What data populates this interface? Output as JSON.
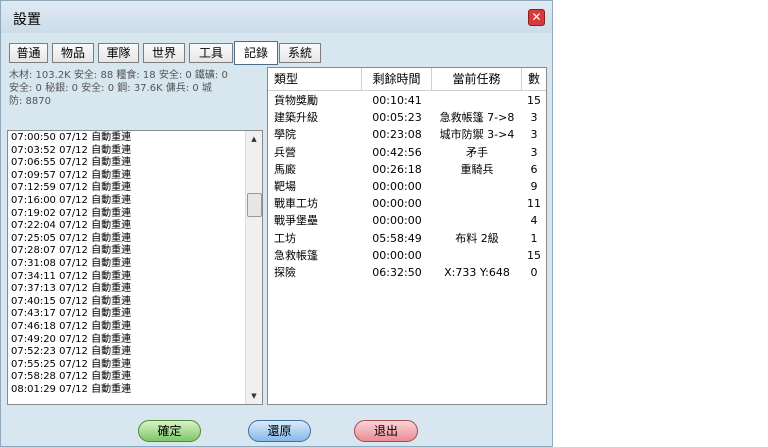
{
  "window": {
    "title": "設置",
    "close_icon": "close-icon"
  },
  "tabs": [
    {
      "label": "普通"
    },
    {
      "label": "物品"
    },
    {
      "label": "軍隊"
    },
    {
      "label": "世界"
    },
    {
      "label": "工具"
    },
    {
      "label": "記錄",
      "active": true
    },
    {
      "label": "系統"
    }
  ],
  "resources": {
    "line1": "木材: 103.2K 安全: 88  糧食: 18 安全: 0  鐵礦: 0",
    "line2": "安全: 0  秘銀: 0 安全: 0  鋼: 37.6K  傭兵: 0  城",
    "line3": "防: 8870"
  },
  "log": [
    "07:00:50 07/12  自動重連",
    "07:03:52 07/12  自動重連",
    "07:06:55 07/12  自動重連",
    "07:09:57 07/12  自動重連",
    "07:12:59 07/12  自動重連",
    "07:16:00 07/12  自動重連",
    "07:19:02 07/12  自動重連",
    "07:22:04 07/12  自動重連",
    "07:25:05 07/12  自動重連",
    "07:28:07 07/12  自動重連",
    "07:31:08 07/12  自動重連",
    "07:34:11 07/12  自動重連",
    "07:37:13 07/12  自動重連",
    "07:40:15 07/12  自動重連",
    "07:43:17 07/12  自動重連",
    "07:46:18 07/12  自動重連",
    "07:49:20 07/12  自動重連",
    "07:52:23 07/12  自動重連",
    "07:55:25 07/12  自動重連",
    "07:58:28 07/12  自動重連",
    "08:01:29 07/12  自動重連"
  ],
  "table": {
    "headers": [
      "類型",
      "剩餘時間",
      "當前任務",
      "數"
    ],
    "rows": [
      [
        "貨物獎勵",
        "00:10:41",
        "",
        "15"
      ],
      [
        "建築升級",
        "00:05:23",
        "急救帳篷 7->8",
        "3"
      ],
      [
        "學院",
        "00:23:08",
        "城市防禦 3->4",
        "3"
      ],
      [
        "兵營",
        "00:42:56",
        "矛手",
        "3"
      ],
      [
        "馬廄",
        "00:26:18",
        "重騎兵",
        "6"
      ],
      [
        "靶場",
        "00:00:00",
        "",
        "9"
      ],
      [
        "戰車工坊",
        "00:00:00",
        "",
        "11"
      ],
      [
        "戰爭堡壘",
        "00:00:00",
        "",
        "4"
      ],
      [
        "工坊",
        "05:58:49",
        "布料 2級",
        "1"
      ],
      [
        "急救帳篷",
        "00:00:00",
        "",
        "15"
      ],
      [
        "探險",
        "06:32:50",
        "X:733 Y:648",
        "0"
      ]
    ]
  },
  "buttons": {
    "ok": "確定",
    "reset": "還原",
    "exit": "退出"
  }
}
